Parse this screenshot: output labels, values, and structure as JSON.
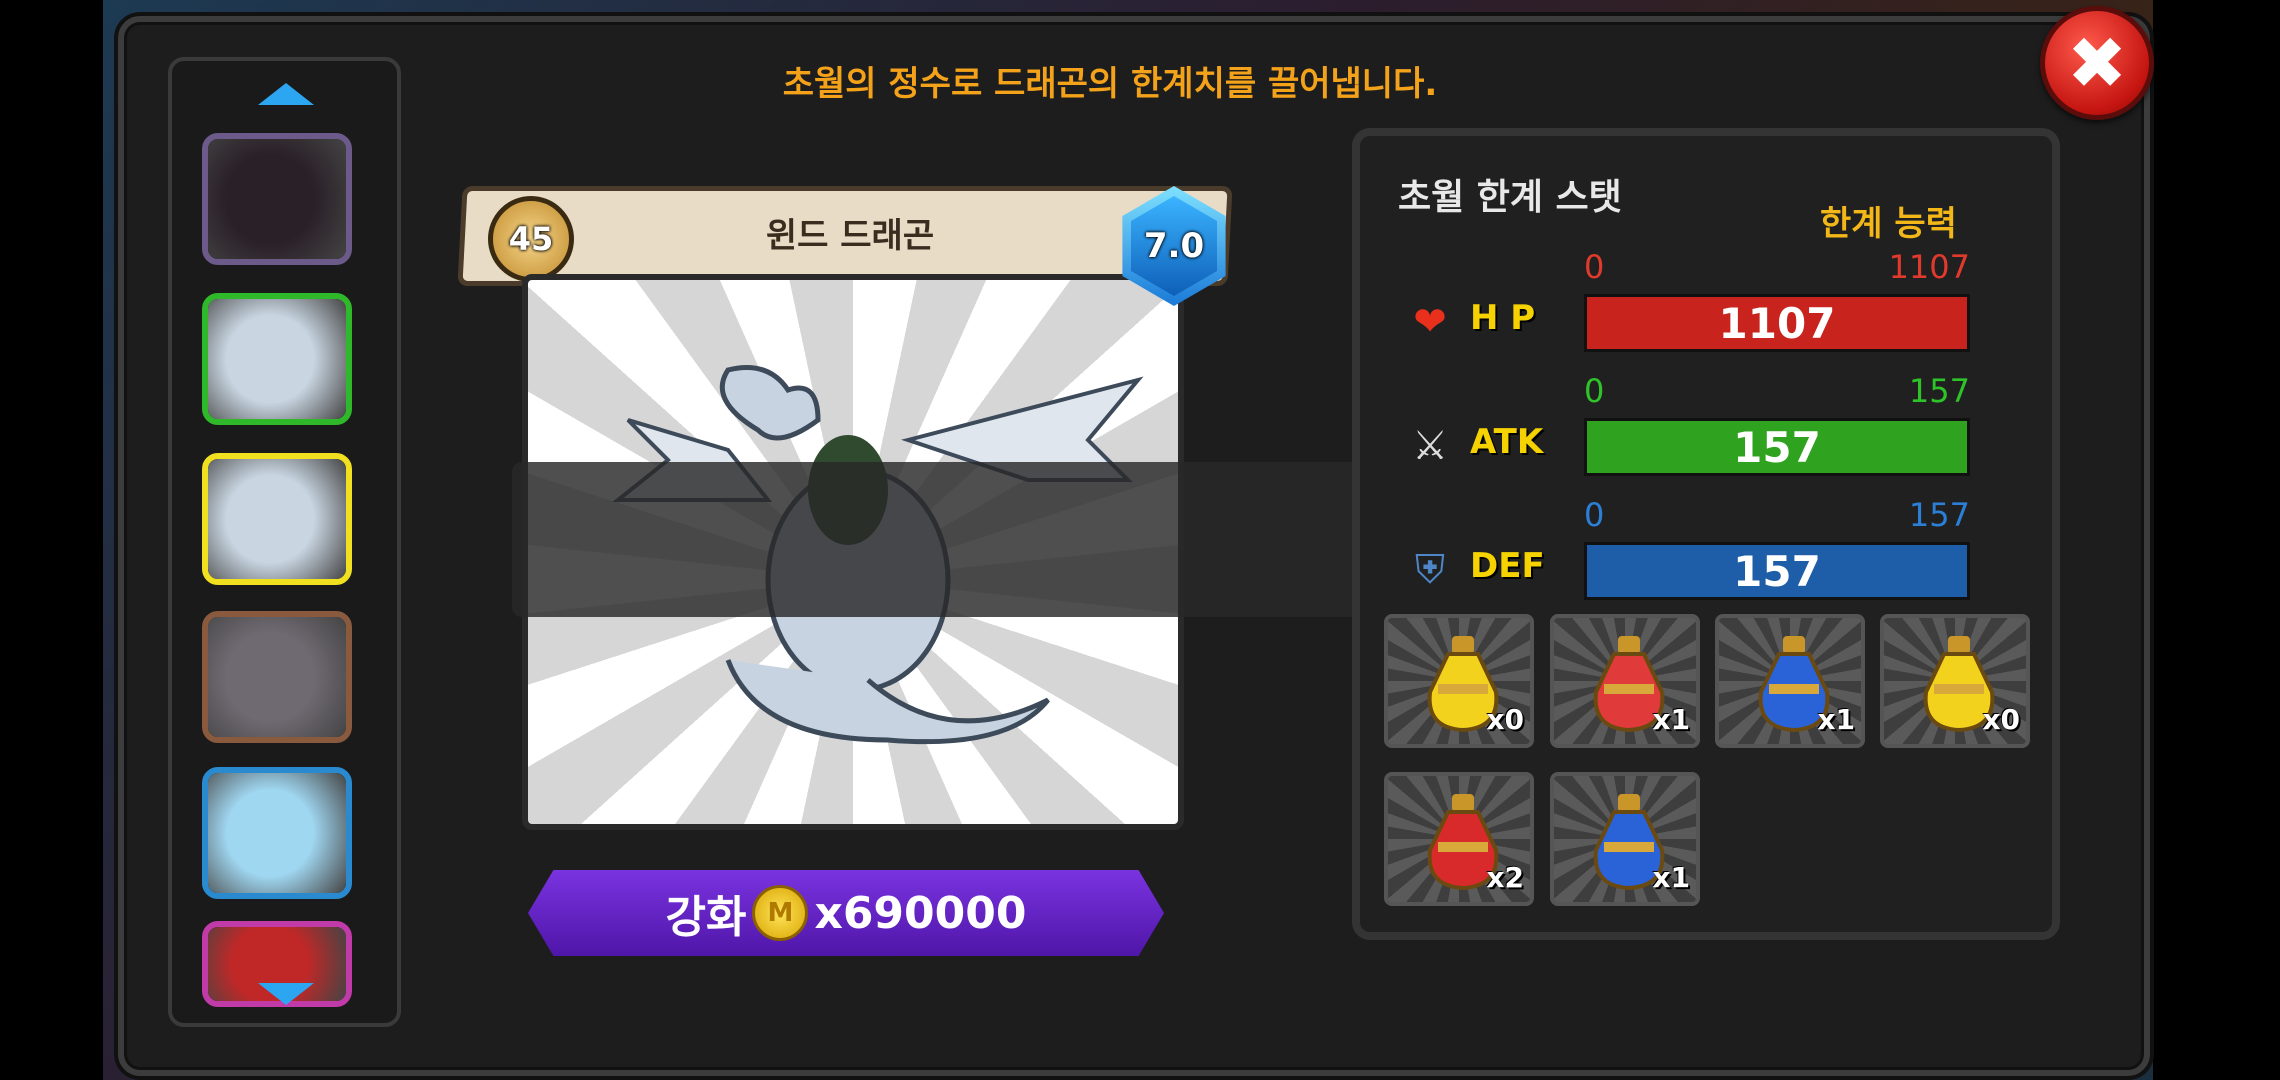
{
  "headline": "초월의 정수로 드래곤의 한계치를 끌어냅니다.",
  "close_icon": "close-icon",
  "dragon": {
    "level": "45",
    "name": "윈드 드래곤",
    "grade": "7.0"
  },
  "enhance": {
    "label": "강화",
    "coin_symbol": "M",
    "cost": "x690000"
  },
  "stats_panel": {
    "title": "초월 한계 스탯",
    "subtitle": "한계 능력",
    "stats": [
      {
        "label": "H P",
        "min": "0",
        "max": "1107",
        "value": "1107",
        "color": "#c8231c",
        "text_color": "#e03a2c",
        "icon": "heart-icon"
      },
      {
        "label": "ATK",
        "min": "0",
        "max": "157",
        "value": "157",
        "color": "#2fa31f",
        "text_color": "#2fc32a",
        "icon": "crossed-swords-icon"
      },
      {
        "label": "DEF",
        "min": "0",
        "max": "157",
        "value": "157",
        "color": "#1e5ea8",
        "text_color": "#2b7fd6",
        "icon": "shield-icon"
      }
    ]
  },
  "potions": [
    {
      "qty": "x0",
      "color": "#f2d21c"
    },
    {
      "qty": "x1",
      "color": "#e03a3a"
    },
    {
      "qty": "x1",
      "color": "#2a62d8"
    },
    {
      "qty": "x0",
      "color": "#f2d21c"
    },
    {
      "qty": "x2",
      "color": "#d82a2a"
    },
    {
      "qty": "x1",
      "color": "#2a62d8"
    }
  ],
  "dragon_list": [
    {
      "color": "#6b5a8a",
      "body": "#2a2028"
    },
    {
      "color": "#2fb82a",
      "body": "#c9d6e2"
    },
    {
      "color": "#f0e020",
      "body": "#c9d6e2"
    },
    {
      "color": "#8a5a3e",
      "body": "#6f6a72"
    },
    {
      "color": "#2a8ad0",
      "body": "#9fd6f0"
    },
    {
      "color": "#c03aa8",
      "body": "#c02828"
    }
  ]
}
